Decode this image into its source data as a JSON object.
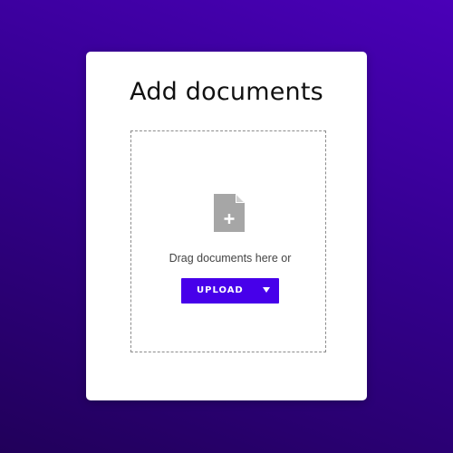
{
  "dialog": {
    "title": "Add documents"
  },
  "dropzone": {
    "icon": "file-add-icon",
    "instruction": "Drag documents here or"
  },
  "upload_button": {
    "label": "UPLOAD",
    "dropdown_icon": "caret-down-icon"
  },
  "colors": {
    "background_start": "#4a00b8",
    "background_end": "#21005a",
    "accent": "#4700ea",
    "icon_gray": "#a6a6a6"
  }
}
